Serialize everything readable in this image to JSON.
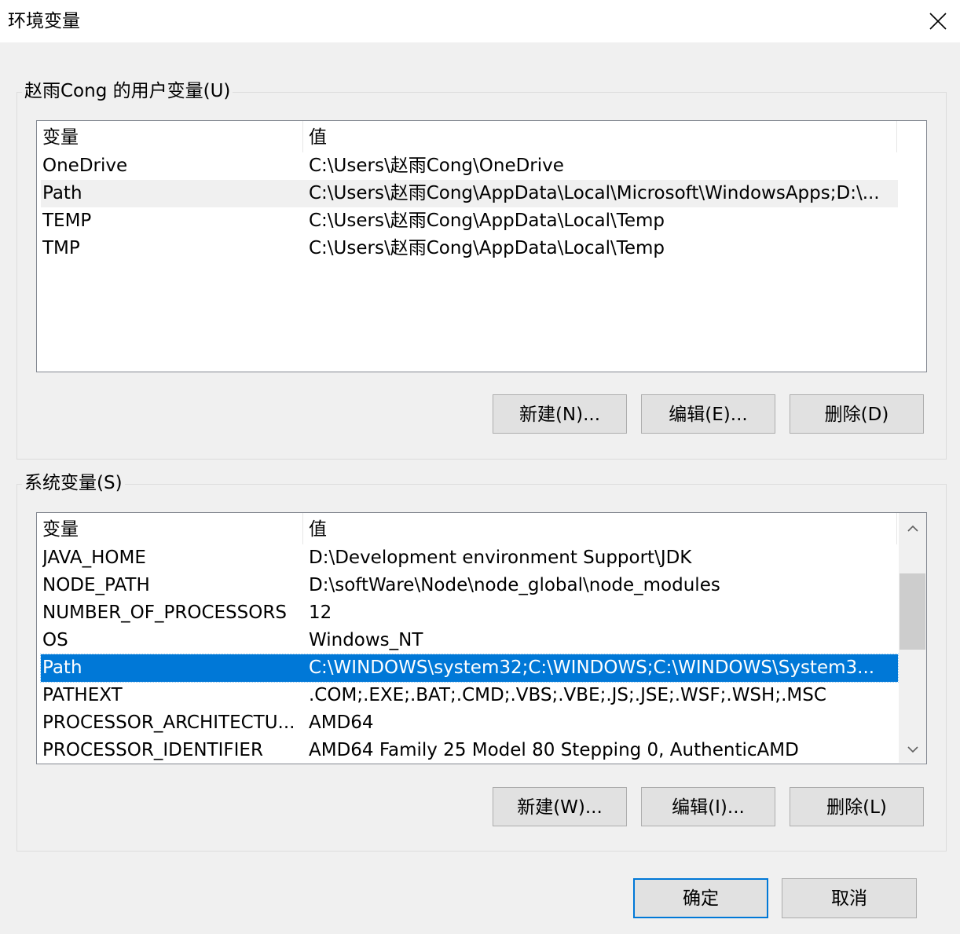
{
  "window": {
    "title": "环境变量",
    "close_icon": "close-icon"
  },
  "user_vars": {
    "group_label": "赵雨Cong 的用户变量(U)",
    "columns": [
      "变量",
      "值"
    ],
    "rows": [
      {
        "name": "OneDrive",
        "value": "C:\\Users\\赵雨Cong\\OneDrive"
      },
      {
        "name": "Path",
        "value": "C:\\Users\\赵雨Cong\\AppData\\Local\\Microsoft\\WindowsApps;D:\\..."
      },
      {
        "name": "TEMP",
        "value": "C:\\Users\\赵雨Cong\\AppData\\Local\\Temp"
      },
      {
        "name": "TMP",
        "value": "C:\\Users\\赵雨Cong\\AppData\\Local\\Temp"
      }
    ],
    "hover_row": "Path",
    "buttons": {
      "new": "新建(N)...",
      "edit": "编辑(E)...",
      "delete": "删除(D)"
    }
  },
  "system_vars": {
    "group_label": "系统变量(S)",
    "columns": [
      "变量",
      "值"
    ],
    "rows": [
      {
        "name": "JAVA_HOME",
        "value": "D:\\Development environment Support\\JDK"
      },
      {
        "name": "NODE_PATH",
        "value": "D:\\softWare\\Node\\node_global\\node_modules"
      },
      {
        "name": "NUMBER_OF_PROCESSORS",
        "value": "12"
      },
      {
        "name": "OS",
        "value": "Windows_NT"
      },
      {
        "name": "Path",
        "value": "C:\\WINDOWS\\system32;C:\\WINDOWS;C:\\WINDOWS\\System3..."
      },
      {
        "name": "PATHEXT",
        "value": ".COM;.EXE;.BAT;.CMD;.VBS;.VBE;.JS;.JSE;.WSF;.WSH;.MSC"
      },
      {
        "name": "PROCESSOR_ARCHITECTU...",
        "value": "AMD64"
      },
      {
        "name": "PROCESSOR_IDENTIFIER",
        "value": "AMD64 Family 25 Model 80 Stepping 0, AuthenticAMD"
      }
    ],
    "selected_row": "Path",
    "buttons": {
      "new": "新建(W)...",
      "edit": "编辑(I)...",
      "delete": "删除(L)"
    }
  },
  "footer": {
    "ok": "确定",
    "cancel": "取消"
  },
  "colors": {
    "selection": "#0078d7",
    "dialog_bg": "#f0f0f0",
    "button_bg": "#e1e1e1"
  }
}
